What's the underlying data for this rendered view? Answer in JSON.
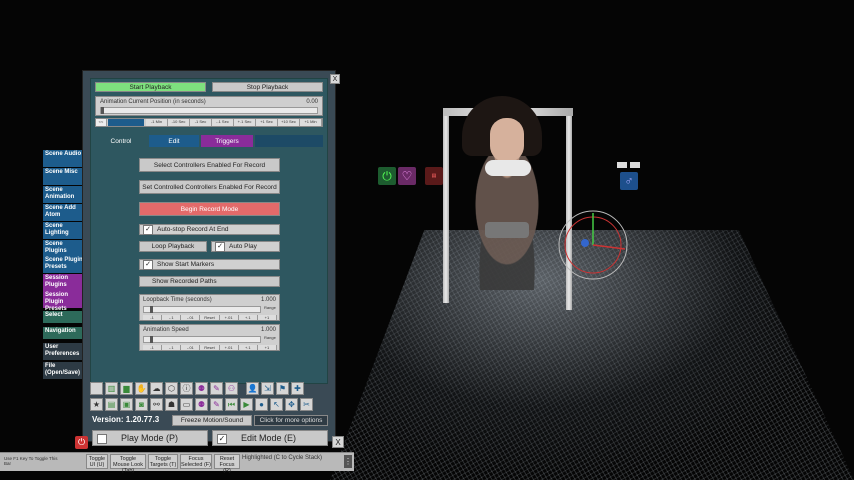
{
  "playback": {
    "start": "Start Playback",
    "stop": "Stop Playback",
    "position_label": "Animation Current Position (in seconds)",
    "position_value": "0.00",
    "position_fraction": 0.0,
    "nav_prev": "<<",
    "steps": [
      "-1 Min",
      "-10 Sec",
      "-1 Sec",
      "-.1 Sec",
      "+.1 Sec",
      "+1 Sec",
      "+10 Sec",
      "+1 Min"
    ]
  },
  "tabs": {
    "control": "Control",
    "edit": "Edit",
    "triggers": "Triggers"
  },
  "control": {
    "select_controllers": "Select Controllers Enabled For Record",
    "set_controllers": "Set Controlled Controllers Enabled For Record",
    "begin_record": "Begin Record Mode",
    "auto_stop": "Auto-stop Record At End",
    "loop_playback": "Loop Playback",
    "auto_play": "Auto Play",
    "show_start_markers": "Show Start Markers",
    "show_recorded_paths": "Show Recorded Paths",
    "loopback_label": "Loopback Time (seconds)",
    "loopback_value": "1.000",
    "loopback_fraction": 0.05,
    "anim_speed_label": "Animation Speed",
    "anim_speed_value": "1.000",
    "anim_speed_fraction": 0.05,
    "range_label": "Range",
    "range_steps": [
      "-1",
      "-.1",
      "-.01",
      "Reset",
      "+.01",
      "+.1",
      "+1"
    ]
  },
  "sidebar": {
    "items": [
      {
        "label": "Scene Audio",
        "color": "#1d5c8c"
      },
      {
        "label": "Scene Misc",
        "color": "#1d5c8c"
      },
      {
        "label": "Scene Animation",
        "color": "#1d5c8c"
      },
      {
        "label": "Scene Add Atom",
        "color": "#1d5c8c"
      },
      {
        "label": "Scene Lighting",
        "color": "#1d5c8c"
      },
      {
        "label": "Scene Plugins",
        "color": "#1d5c8c"
      },
      {
        "label": "Scene Plugin Presets",
        "color": "#1d5c8c"
      },
      {
        "label": "Session Plugins",
        "color": "#8a2c9a"
      },
      {
        "label": "Session Plugin Presets",
        "color": "#8a2c9a"
      },
      {
        "label": "Select",
        "color": "#2d6a5a"
      },
      {
        "label": "Navigation",
        "color": "#2d6a5a"
      },
      {
        "label": "User Preferences",
        "color": "#2d3a44"
      },
      {
        "label": "File (Open/Save)",
        "color": "#2d3a44"
      }
    ]
  },
  "footer": {
    "version": "Version: 1.20.77.3",
    "freeze": "Freeze Motion/Sound",
    "more_options": "Click for more options",
    "play_mode": "Play Mode (P)",
    "edit_mode": "Edit Mode (E)",
    "close": "X"
  },
  "bottom_bar": {
    "hint": "Use F1 Key To Toggle This Bar",
    "buttons": [
      "Toggle UI (U)",
      "Toggle Mouse Look (Tab)",
      "Toggle Targets (T)",
      "Focus Selected (F)",
      "Reset Focus (R)"
    ],
    "status": "Highlighted (C to Cycle Stack)"
  },
  "panel_close": "X"
}
